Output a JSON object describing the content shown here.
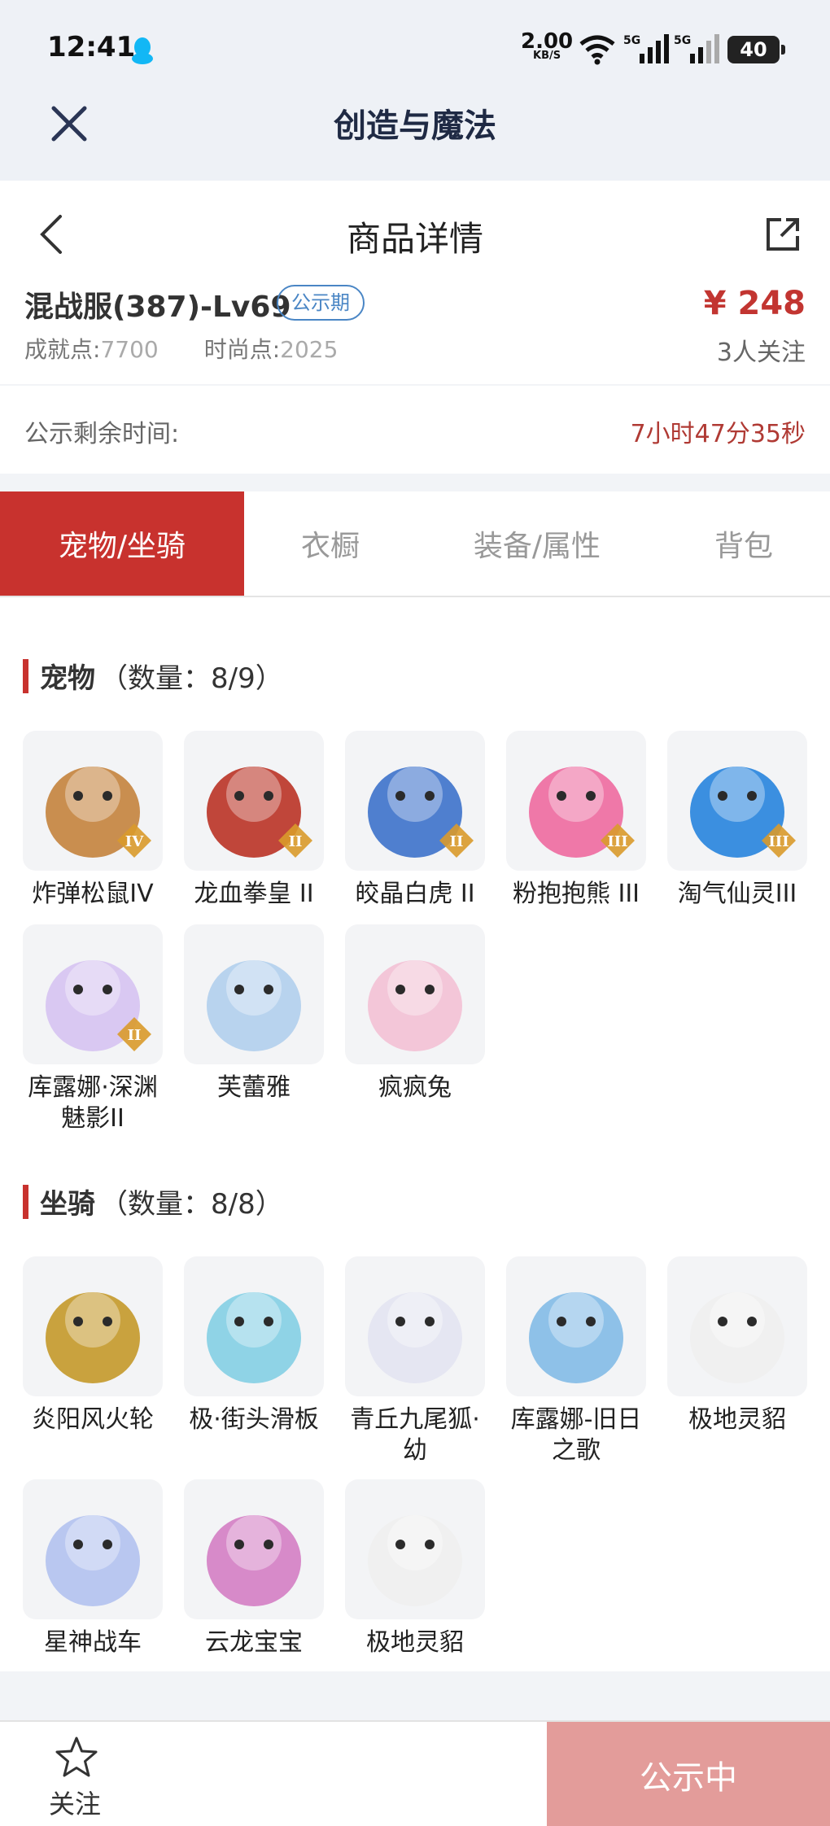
{
  "status_bar": {
    "time": "12:41",
    "speed": "2.00",
    "speed_unit": "KB/S",
    "net1": "5G",
    "net2": "5G",
    "battery": "40"
  },
  "app": {
    "title": "创造与魔法"
  },
  "nav": {
    "title": "商品详情"
  },
  "product": {
    "name": "混战服(387)-Lv69",
    "badge": "公示期",
    "price": "¥ 248",
    "achievement_label": "成就点:",
    "achievement_value": "7700",
    "fashion_label": "时尚点:",
    "fashion_value": "2025",
    "followers": "3人关注"
  },
  "timer": {
    "label": "公示剩余时间:",
    "value": "7小时47分35秒"
  },
  "tabs": [
    {
      "label": "宠物/坐骑",
      "active": true
    },
    {
      "label": "衣橱",
      "active": false
    },
    {
      "label": "装备/属性",
      "active": false
    },
    {
      "label": "背包",
      "active": false
    }
  ],
  "pets": {
    "title": "宠物",
    "count": "（数量：8/9）",
    "items": [
      {
        "name": "炸弹松鼠IV",
        "grade": "IV",
        "color": "#c98e4f"
      },
      {
        "name": "龙血拳皇 II",
        "grade": "II",
        "color": "#c0463a"
      },
      {
        "name": "皎晶白虎 II",
        "grade": "II",
        "color": "#4f7fcf"
      },
      {
        "name": "粉抱抱熊 III",
        "grade": "III",
        "color": "#ef78a8"
      },
      {
        "name": "淘气仙灵III",
        "grade": "III",
        "color": "#3b8fe0"
      },
      {
        "name": "库露娜·深渊魅影II",
        "grade": "II",
        "color": "#d9c8f2"
      },
      {
        "name": "芙蕾雅",
        "grade": "",
        "color": "#b8d3ee"
      },
      {
        "name": "疯疯兔",
        "grade": "",
        "color": "#f3c6d8"
      }
    ]
  },
  "mounts": {
    "title": "坐骑",
    "count": "（数量：8/8）",
    "items": [
      {
        "name": "炎阳风火轮",
        "color": "#c9a23e"
      },
      {
        "name": "极·街头滑板",
        "color": "#8fd3e6"
      },
      {
        "name": "青丘九尾狐·幼",
        "color": "#e5e6f2"
      },
      {
        "name": "库露娜-旧日之歌",
        "color": "#8ec1e8"
      },
      {
        "name": "极地灵貂",
        "color": "#f0f0f0"
      },
      {
        "name": "星神战车",
        "color": "#b9c7f0"
      },
      {
        "name": "云龙宝宝",
        "color": "#d78ac9"
      },
      {
        "name": "极地灵貂",
        "color": "#f0f0f0"
      }
    ]
  },
  "bottom": {
    "follow_label": "关注",
    "status_label": "公示中"
  }
}
